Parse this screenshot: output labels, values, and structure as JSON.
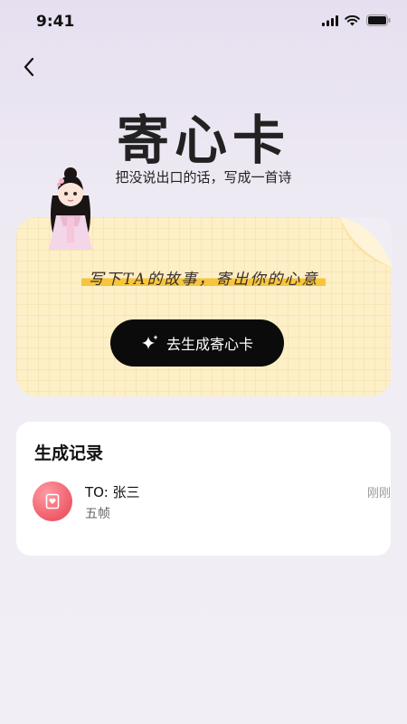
{
  "status_bar": {
    "time": "9:41"
  },
  "header": {
    "title": "寄心卡",
    "subtitle": "把没说出口的话，写成一首诗"
  },
  "card": {
    "slogan": "写下TA的故事，寄出你的心意",
    "button_label": "去生成寄心卡"
  },
  "records": {
    "title": "生成记录",
    "items": [
      {
        "to": "TO: 张三",
        "subtitle": "五帧",
        "time": "刚刚"
      }
    ]
  },
  "icons": [
    "back-arrow-icon",
    "sparkle-icon",
    "card-heart-icon",
    "signal-icon",
    "wifi-icon",
    "battery-icon"
  ],
  "colors": {
    "button": "#0b0b0b",
    "card_paper": "#fdefc6",
    "highlight": "#f6c53a",
    "avatar": "#ef5b68"
  }
}
